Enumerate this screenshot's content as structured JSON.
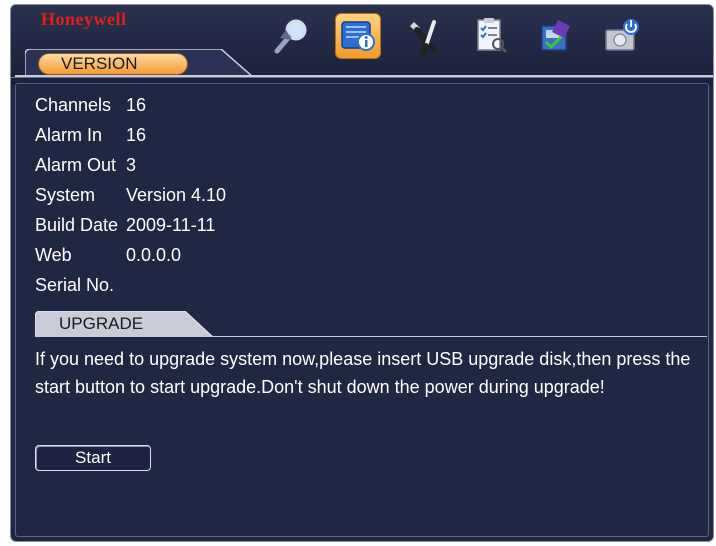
{
  "brand": "Honeywell",
  "tab": {
    "label": "VERSION"
  },
  "toolbar": {
    "icons": [
      {
        "name": "search-icon",
        "active": false
      },
      {
        "name": "info-icon",
        "active": true
      },
      {
        "name": "tools-icon",
        "active": false
      },
      {
        "name": "checklist-icon",
        "active": false
      },
      {
        "name": "backup-icon",
        "active": false
      },
      {
        "name": "shutdown-icon",
        "active": false
      }
    ]
  },
  "info": {
    "rows": [
      {
        "label": "Channels",
        "value": "16"
      },
      {
        "label": "Alarm In",
        "value": "16"
      },
      {
        "label": "Alarm Out",
        "value": "3"
      },
      {
        "label": "System",
        "value": "Version 4.10"
      },
      {
        "label": "Build Date",
        "value": "2009-11-11"
      },
      {
        "label": "Web",
        "value": "0.0.0.0"
      },
      {
        "label": "Serial No.",
        "value": ""
      }
    ]
  },
  "upgrade": {
    "section_label": "UPGRADE",
    "message": "If you need to upgrade system now,please insert USB upgrade disk,then press the start button to start upgrade.Don't shut down the power during upgrade!",
    "start_label": "Start"
  },
  "colors": {
    "brand": "#e1201a",
    "accent": "#f39a33",
    "background": "#202742"
  }
}
